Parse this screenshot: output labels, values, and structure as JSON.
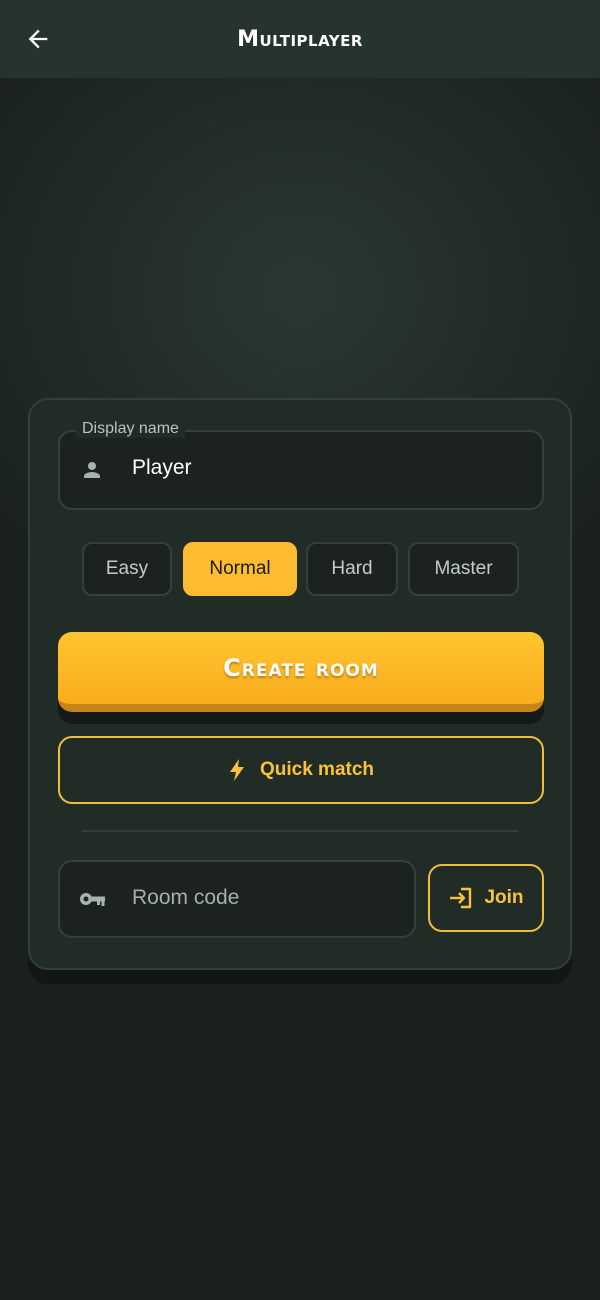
{
  "header": {
    "title": "Multiplayer",
    "back_icon": "arrow-left-icon"
  },
  "form": {
    "display_name_label": "Display name",
    "display_name_value": "Player",
    "name_icon": "person-icon",
    "difficulties": [
      {
        "label": "Easy",
        "selected": false
      },
      {
        "label": "Normal",
        "selected": true
      },
      {
        "label": "Hard",
        "selected": false
      },
      {
        "label": "Master",
        "selected": false
      }
    ],
    "create_label": "Create room",
    "quick_match_label": "Quick match",
    "quick_match_icon": "lightning-bolt-icon",
    "room_code_placeholder": "Room code",
    "room_code_icon": "key-icon",
    "join_label": "Join",
    "join_icon": "login-icon"
  },
  "colors": {
    "accent": "#fdbb30",
    "background": "#212b26",
    "card": "#222c27",
    "header": "#27332d"
  }
}
